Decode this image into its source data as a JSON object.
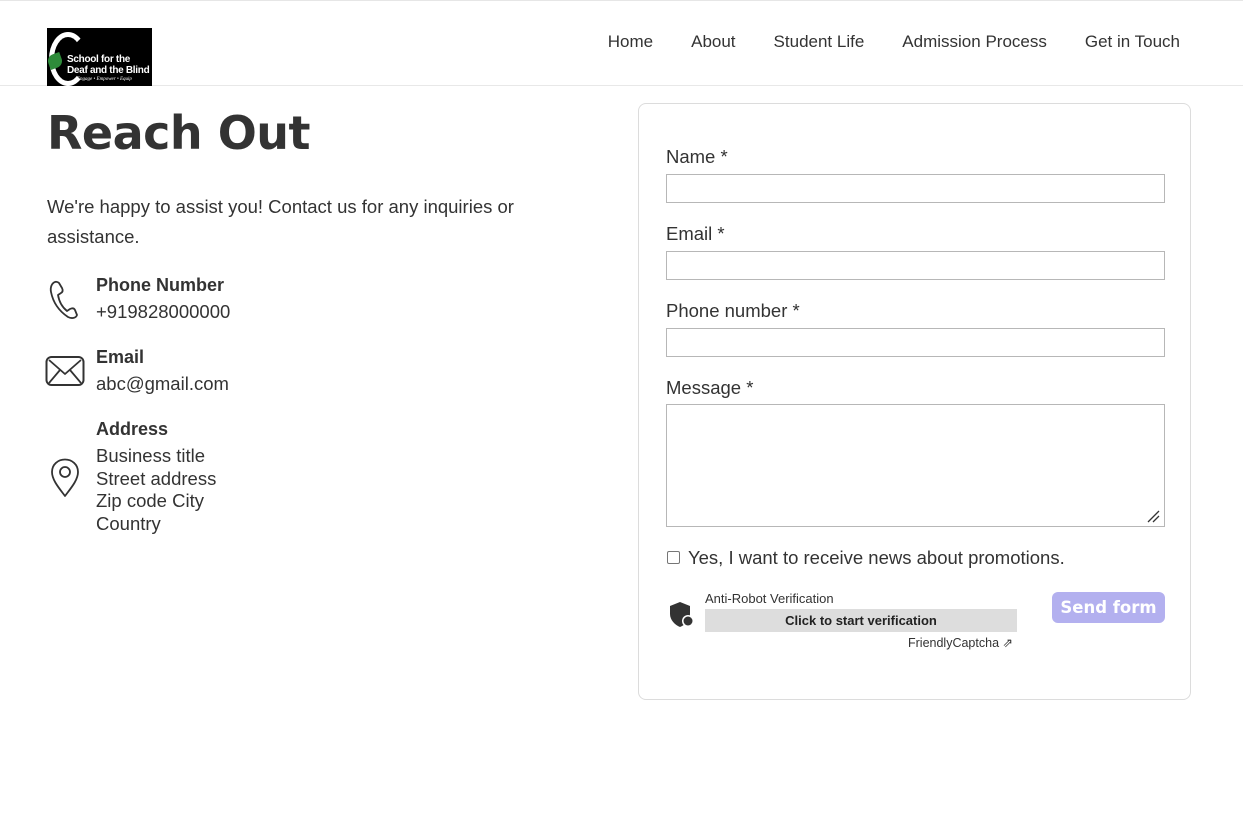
{
  "logo": {
    "line1": "School for the",
    "line2": "Deaf and the Blind",
    "tagline": "Engage • Empower • Equip"
  },
  "nav": {
    "items": [
      "Home",
      "About",
      "Student Life",
      "Admission Process",
      "Get in Touch"
    ]
  },
  "page": {
    "title": "Reach Out",
    "intro": "We're happy to assist you! Contact us for any inquiries or assistance."
  },
  "contact": {
    "phone": {
      "title": "Phone Number",
      "value": "+919828000000"
    },
    "email": {
      "title": "Email",
      "value": "abc@gmail.com"
    },
    "address": {
      "title": "Address",
      "lines": [
        "Business title",
        "Street address",
        "Zip code City",
        "Country"
      ]
    }
  },
  "form": {
    "name_label": "Name *",
    "email_label": "Email *",
    "phone_label": "Phone number *",
    "message_label": "Message *",
    "name_value": "",
    "email_value": "",
    "phone_value": "",
    "message_value": "",
    "newsletter_label": "Yes, I want to receive news about promotions.",
    "newsletter_checked": false,
    "captcha": {
      "title": "Anti-Robot Verification",
      "button": "Click to start verification",
      "brand": "FriendlyCaptcha ⇗"
    },
    "submit_label": "Send form"
  },
  "colors": {
    "text": "#333333",
    "submit_bg": "#b3b0ef",
    "captcha_button_bg": "#dddddd",
    "card_border": "#dcdcdc"
  },
  "icons": [
    "phone-icon",
    "envelope-icon",
    "map-pin-icon",
    "shield-icon",
    "resize-grip-icon"
  ]
}
